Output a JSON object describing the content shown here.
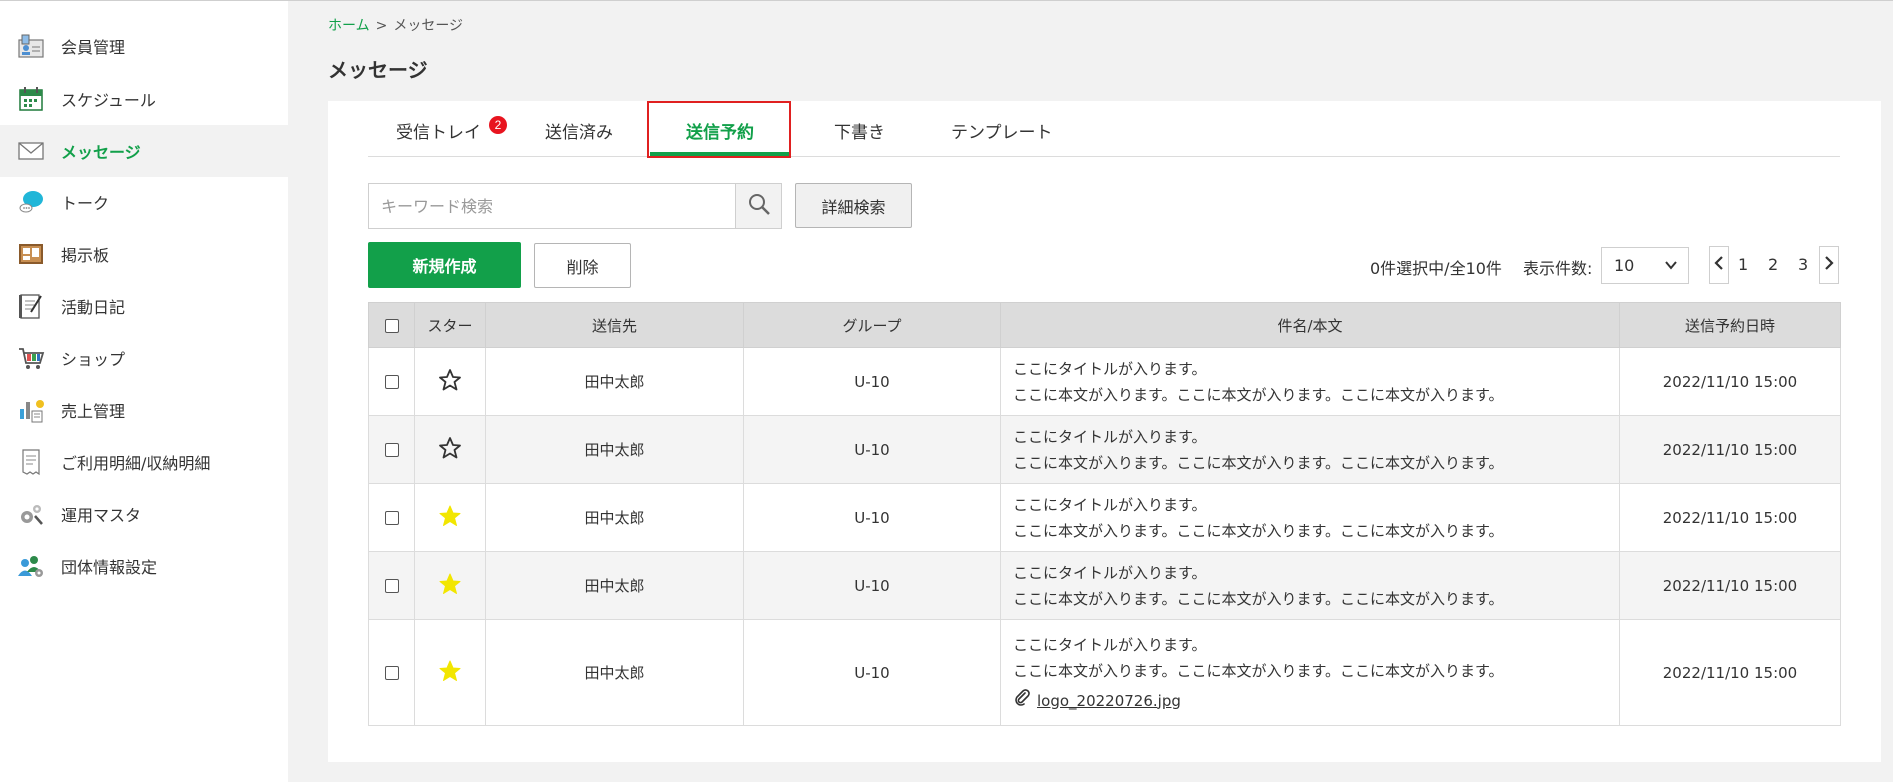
{
  "sidebar": {
    "items": [
      {
        "label": "会員管理",
        "icon": "member-card-icon"
      },
      {
        "label": "スケジュール",
        "icon": "calendar-icon"
      },
      {
        "label": "メッセージ",
        "icon": "envelope-icon",
        "active": true
      },
      {
        "label": "トーク",
        "icon": "chat-bubble-icon"
      },
      {
        "label": "掲示板",
        "icon": "bulletin-board-icon"
      },
      {
        "label": "活動日記",
        "icon": "diary-icon"
      },
      {
        "label": "ショップ",
        "icon": "shopping-cart-icon"
      },
      {
        "label": "売上管理",
        "icon": "sales-chart-icon"
      },
      {
        "label": "ご利用明細/収納明細",
        "icon": "receipt-icon"
      },
      {
        "label": "運用マスタ",
        "icon": "settings-gears-icon"
      },
      {
        "label": "団体情報設定",
        "icon": "group-settings-icon"
      }
    ]
  },
  "breadcrumb": {
    "home": "ホーム",
    "separator": ">",
    "current": "メッセージ"
  },
  "page_title": "メッセージ",
  "tabs": [
    {
      "label": "受信トレイ",
      "badge": "2"
    },
    {
      "label": "送信済み"
    },
    {
      "label": "送信予約",
      "active": true
    },
    {
      "label": "下書き"
    },
    {
      "label": "テンプレート"
    }
  ],
  "search": {
    "placeholder": "キーワード検索",
    "value": ""
  },
  "buttons": {
    "detail_search": "詳細検索",
    "new": "新規作成",
    "delete": "削除"
  },
  "selection_count": "0件選択中/全10件",
  "per_page": {
    "label": "表示件数:",
    "value": "10"
  },
  "pagination": {
    "pages": [
      "1",
      "2",
      "3"
    ]
  },
  "table": {
    "headers": [
      "スター",
      "送信先",
      "グループ",
      "件名/本文",
      "送信予約日時"
    ],
    "rows": [
      {
        "starred": false,
        "recipient": "田中太郎",
        "group": "U-10",
        "title": "ここにタイトルが入ります。",
        "body": "ここに本文が入ります。ここに本文が入ります。ここに本文が入ります。",
        "datetime": "2022/11/10 15:00"
      },
      {
        "starred": false,
        "recipient": "田中太郎",
        "group": "U-10",
        "title": "ここにタイトルが入ります。",
        "body": "ここに本文が入ります。ここに本文が入ります。ここに本文が入ります。",
        "datetime": "2022/11/10 15:00"
      },
      {
        "starred": true,
        "recipient": "田中太郎",
        "group": "U-10",
        "title": "ここにタイトルが入ります。",
        "body": "ここに本文が入ります。ここに本文が入ります。ここに本文が入ります。",
        "datetime": "2022/11/10 15:00"
      },
      {
        "starred": true,
        "recipient": "田中太郎",
        "group": "U-10",
        "title": "ここにタイトルが入ります。",
        "body": "ここに本文が入ります。ここに本文が入ります。ここに本文が入ります。",
        "datetime": "2022/11/10 15:00"
      },
      {
        "starred": true,
        "recipient": "田中太郎",
        "group": "U-10",
        "title": "ここにタイトルが入ります。",
        "body": "ここに本文が入ります。ここに本文が入ります。ここに本文が入ります。",
        "datetime": "2022/11/10 15:00",
        "attachment": "logo_20220726.jpg"
      }
    ]
  },
  "colors": {
    "accent": "#12a04a",
    "star_filled": "#f2e600",
    "badge": "#e8141f",
    "highlight_border": "#e02020"
  }
}
